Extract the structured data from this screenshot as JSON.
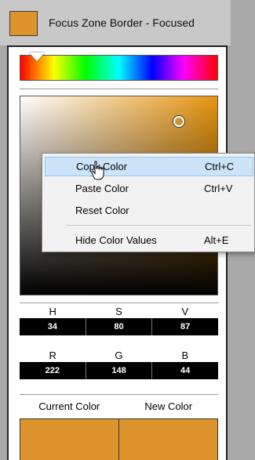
{
  "header": {
    "title": "Focus Zone Border - Focused"
  },
  "colors": {
    "current": "#de942c",
    "new": "#de942c",
    "accent": "#de942c"
  },
  "hsv": {
    "labels": [
      "H",
      "S",
      "V"
    ],
    "values": [
      "34",
      "80",
      "87"
    ]
  },
  "rgb": {
    "labels": [
      "R",
      "G",
      "B"
    ],
    "values": [
      "222",
      "148",
      "44"
    ]
  },
  "compare": {
    "current_label": "Current Color",
    "new_label": "New Color"
  },
  "context_menu": {
    "items": [
      {
        "label": "Copy Color",
        "shortcut": "Ctrl+C",
        "highlighted": true
      },
      {
        "label": "Paste Color",
        "shortcut": "Ctrl+V"
      },
      {
        "label": "Reset Color",
        "shortcut": ""
      },
      {
        "label": "Hide Color Values",
        "shortcut": "Alt+E"
      }
    ]
  },
  "icons": {
    "cursor": "hand-pointer-icon",
    "hue_marker": "triangle-marker-icon",
    "sv_marker": "circle-marker-icon"
  }
}
